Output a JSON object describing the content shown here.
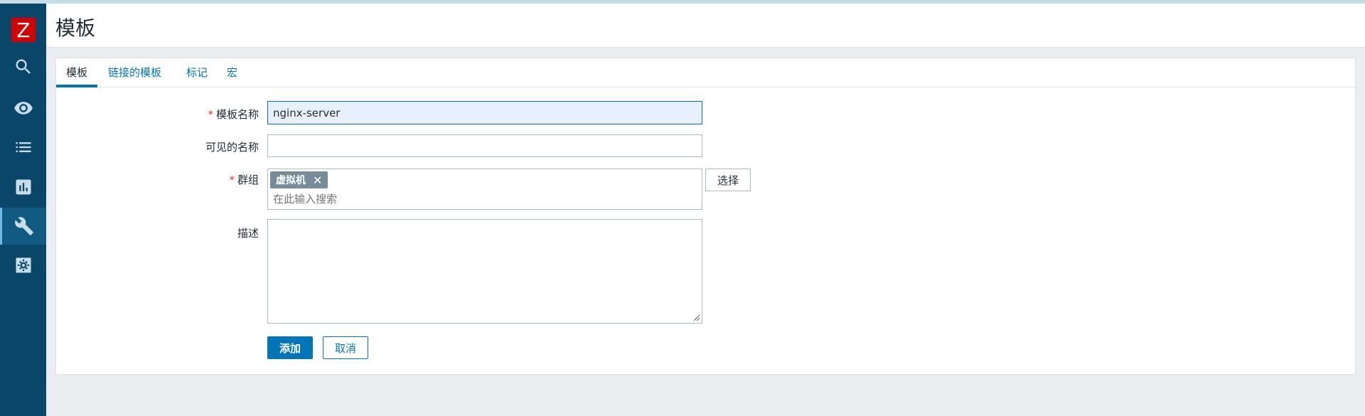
{
  "header": {
    "title": "模板"
  },
  "sidebar": {
    "logo": "Z",
    "items": [
      {
        "icon": "search-icon"
      },
      {
        "icon": "eye-icon"
      },
      {
        "icon": "list-icon"
      },
      {
        "icon": "bar-chart-icon"
      },
      {
        "icon": "wrench-icon",
        "active": true
      },
      {
        "icon": "gear-icon"
      }
    ]
  },
  "tabs": [
    {
      "label": "模板",
      "active": true
    },
    {
      "label": "链接的模板"
    },
    {
      "label": "标记"
    },
    {
      "label": "宏"
    }
  ],
  "form": {
    "template_name": {
      "label": "模板名称",
      "required": "*",
      "value": "nginx-server"
    },
    "visible_name": {
      "label": "可见的名称",
      "value": ""
    },
    "groups": {
      "label": "群组",
      "required": "*",
      "tags": [
        "虚拟机"
      ],
      "remove_glyph": "✕",
      "placeholder": "在此输入搜索",
      "select_label": "选择"
    },
    "description": {
      "label": "描述",
      "value": ""
    }
  },
  "actions": {
    "add_label": "添加",
    "cancel_label": "取消"
  },
  "colors": {
    "accent": "#0275b8",
    "sidebar": "#0a466a",
    "logo": "#d40000",
    "required": "#e33734"
  }
}
